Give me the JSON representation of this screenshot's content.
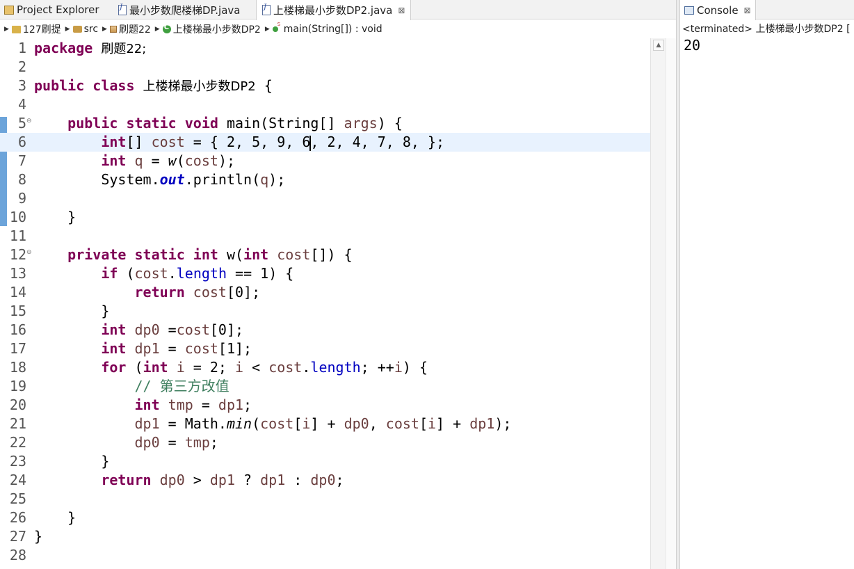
{
  "editor": {
    "tabs": [
      {
        "label": "Project Explorer",
        "icon": "project-explorer-icon"
      },
      {
        "label": "最小步数爬楼梯DP.java",
        "icon": "java-file-icon"
      },
      {
        "label": "上楼梯最小步数DP2.java",
        "icon": "java-file-icon",
        "active": true,
        "close": "⊠"
      }
    ],
    "breadcrumb": [
      "127刷提",
      "src",
      "刷题22",
      "上楼梯最小步数DP2",
      "main(String[]) : void"
    ],
    "current_line": 6,
    "line_numbers": [
      "1",
      "2",
      "3",
      "4",
      "5",
      "6",
      "7",
      "8",
      "9",
      "10",
      "11",
      "12",
      "13",
      "14",
      "15",
      "16",
      "17",
      "18",
      "19",
      "20",
      "21",
      "22",
      "23",
      "24",
      "25",
      "26",
      "27",
      "28"
    ]
  },
  "code": {
    "l1_kw": "package",
    "l1_pkg": "刷题22;",
    "l3_kw": "public class",
    "l3_name": "上楼梯最小步数DP2",
    "l3_brace": "{",
    "l5_kw": "public static void",
    "l5_rest1": "main(String[] ",
    "l5_var": "args",
    "l5_rest2": ") {",
    "l6_kw": "int",
    "l6_rest1": "[] ",
    "l6_var": "cost",
    "l6_rest2": " = { 2, 5, 9, 6",
    "l6_rest3": ", 2, 4, 7, 8, };",
    "l7_kw": "int",
    "l7_var": "q",
    "l7_rest1": " = ",
    "l7_meth": "w",
    "l7_rest2": "(",
    "l7_arg": "cost",
    "l7_rest3": ");",
    "l8_rest1": "System.",
    "l8_fld": "out",
    "l8_rest2": ".println(",
    "l8_var": "q",
    "l8_rest3": ");",
    "l10": "}",
    "l12_kw1": "private static int",
    "l12_rest1": " w(",
    "l12_kw2": "int",
    "l12_var": "cost",
    "l12_rest2": "[]) {",
    "l13_kw": "if",
    "l13_rest1": " (",
    "l13_var": "cost",
    "l13_rest2": ".",
    "l13_fld": "length",
    "l13_rest3": " == 1) {",
    "l14_kw": "return",
    "l14_var": "cost",
    "l14_rest": "[0];",
    "l15": "}",
    "l16_kw": "int",
    "l16_var": "dp0",
    "l16_rest1": " =",
    "l16_var2": "cost",
    "l16_rest2": "[0];",
    "l17_kw": "int",
    "l17_var": "dp1",
    "l17_rest1": " = ",
    "l17_var2": "cost",
    "l17_rest2": "[1];",
    "l18_kw1": "for",
    "l18_rest1": " (",
    "l18_kw2": "int",
    "l18_var": "i",
    "l18_rest2": " = 2; ",
    "l18_var2": "i",
    "l18_rest3": " < ",
    "l18_var3": "cost",
    "l18_rest4": ".",
    "l18_fld": "length",
    "l18_rest5": "; ++",
    "l18_var4": "i",
    "l18_rest6": ") {",
    "l19_cmt": "// ",
    "l19_cjk": "第三方改值",
    "l20_kw": "int",
    "l20_var": "tmp",
    "l20_rest": " = ",
    "l20_var2": "dp1",
    "l20_end": ";",
    "l21_var": "dp1",
    "l21_r1": " = Math.",
    "l21_meth": "min",
    "l21_r2": "(",
    "l21_v2": "cost",
    "l21_r3": "[",
    "l21_v3": "i",
    "l21_r4": "] + ",
    "l21_v4": "dp0",
    "l21_r5": ", ",
    "l21_v5": "cost",
    "l21_r6": "[",
    "l21_v6": "i",
    "l21_r7": "] + ",
    "l21_v7": "dp1",
    "l21_r8": ");",
    "l22_var": "dp0",
    "l22_rest": " = ",
    "l22_var2": "tmp",
    "l22_end": ";",
    "l23": "}",
    "l24_kw": "return",
    "l24_v1": "dp0",
    "l24_r1": " > ",
    "l24_v2": "dp1",
    "l24_r2": " ? ",
    "l24_v3": "dp1",
    "l24_r3": " : ",
    "l24_v4": "dp0",
    "l24_r4": ";",
    "l26": "}",
    "l27": "}"
  },
  "console": {
    "tab_label": "Console",
    "close": "⊠",
    "status": "<terminated> 上楼梯最小步数DP2 [",
    "output": "20"
  },
  "colors": {
    "keyword": "#7f0055",
    "variable": "#6a3e3e",
    "field": "#0000c0",
    "comment": "#3f7f5f",
    "current_line": "#e8f2fe"
  }
}
